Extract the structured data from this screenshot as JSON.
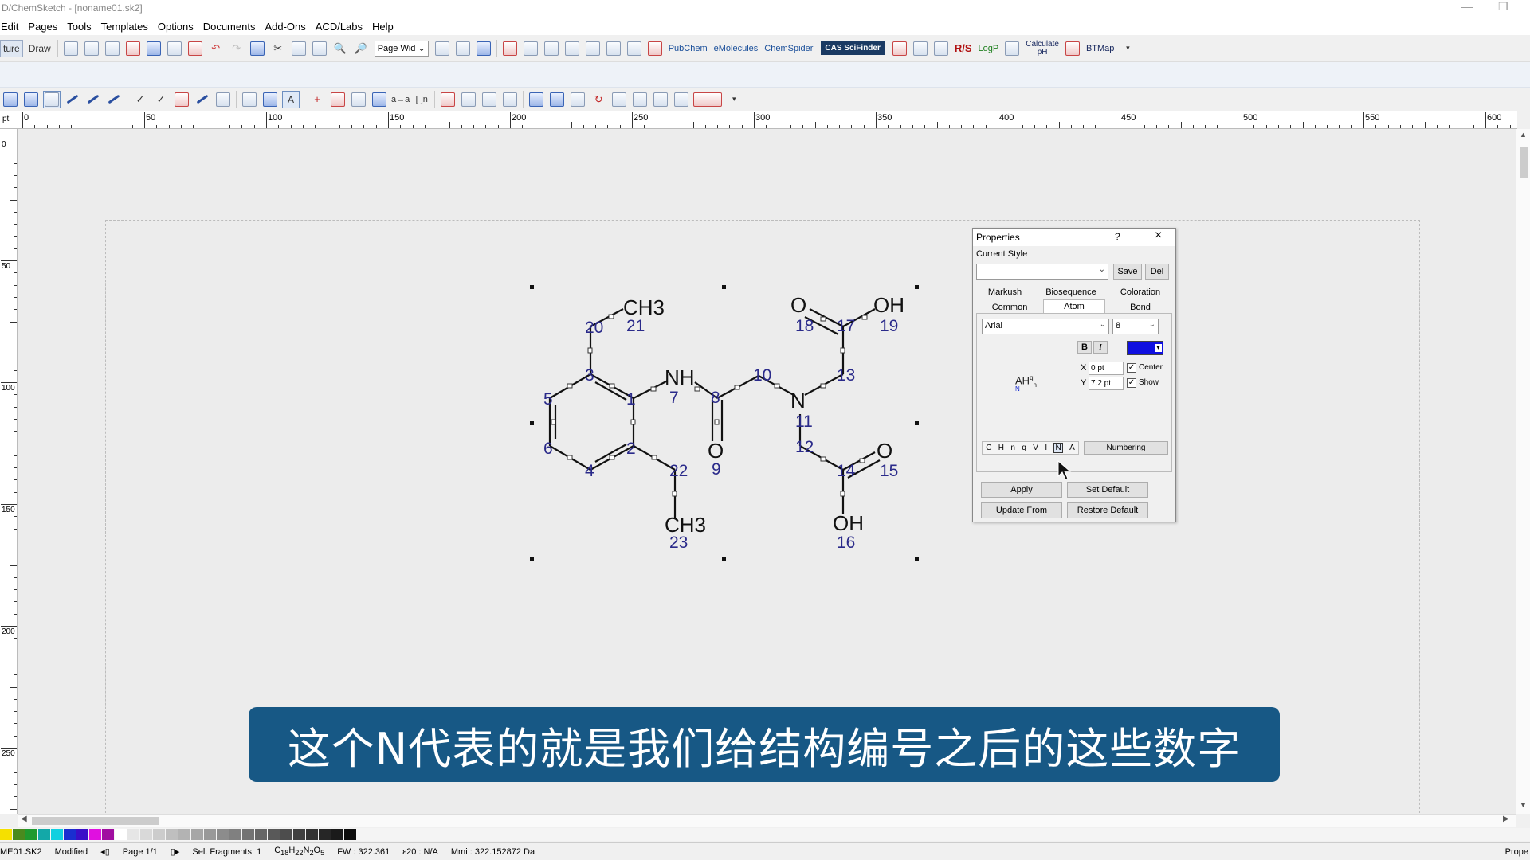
{
  "titlebar": {
    "title": "D/ChemSketch - [noname01.sk2]"
  },
  "menu": [
    "Edit",
    "Pages",
    "Tools",
    "Templates",
    "Options",
    "Documents",
    "Add-Ons",
    "ACD/Labs",
    "Help"
  ],
  "toolbar1": {
    "structure_tab": "ture",
    "draw_tab": "Draw",
    "zoom_select": "Page Wid",
    "pubchem": "PubChem",
    "emolecules": "eMolecules",
    "chemspider": "ChemSpider",
    "cas": "CAS SciFinder",
    "rs": "R/S",
    "logp": "LogP",
    "calculate": "Calculate",
    "ph": "pH",
    "btmap": "BTMap"
  },
  "ruler": {
    "unit": "pt",
    "h_labels": [
      "0",
      "50",
      "100",
      "150",
      "200",
      "250",
      "300",
      "350",
      "400",
      "450",
      "500",
      "550",
      "600"
    ],
    "v_labels": [
      "0",
      "50",
      "100",
      "150",
      "200",
      "250"
    ]
  },
  "molecule": {
    "groups": {
      "ch3_top": "CH3",
      "ch3_bottom": "CH3",
      "nh": "NH",
      "n": "N",
      "o_acid_top": "O",
      "oh_top": "OH",
      "o_9": "O",
      "o_15": "O",
      "oh_16": "OH"
    },
    "numbers": [
      "1",
      "2",
      "3",
      "4",
      "5",
      "6",
      "7",
      "8",
      "9",
      "10",
      "11",
      "12",
      "13",
      "14",
      "15",
      "16",
      "17",
      "18",
      "19",
      "20",
      "21",
      "22",
      "23"
    ]
  },
  "properties": {
    "title": "Properties",
    "help": "?",
    "current_style_label": "Current Style",
    "style_value": "",
    "save": "Save",
    "del": "Del",
    "tabs_row1": [
      "Markush",
      "Biosequence",
      "Coloration"
    ],
    "tabs_row2": [
      "Common",
      "Atom",
      "Bond"
    ],
    "active_tab": "Atom",
    "font": "Arial",
    "size": "8",
    "bold": "B",
    "italic": "I",
    "color": "#1010e0",
    "x_label": "X",
    "x_value": "0 pt",
    "y_label": "Y",
    "y_value": "7.2 pt",
    "center_label": "Center",
    "show_label": "Show",
    "center_checked": true,
    "show_checked": true,
    "preview": "AH",
    "preview_sup": "q",
    "preview_sub": "n",
    "preview_n": "N",
    "label_flags": [
      "C",
      "H",
      "n",
      "q",
      "V",
      "I",
      "N",
      "A"
    ],
    "numbering": "Numbering",
    "apply": "Apply",
    "set_default": "Set Default",
    "update_from": "Update From",
    "restore_default": "Restore Default"
  },
  "caption": "这个N代表的就是我们给结构编号之后的这些数字",
  "status": {
    "file": "ME01.SK2",
    "modified": "Modified",
    "page": "Page 1/1",
    "sel": "Sel. Fragments: 1",
    "formula": "C18H22N2O5",
    "fw": "FW : 322.361",
    "e20": "ε20 : N/A",
    "mmi": "Mmi : 322.152872 Da",
    "right": "Prope"
  },
  "palette": [
    "#f5e000",
    "#4a8a1e",
    "#1f9a2e",
    "#13a8a8",
    "#11d0e0",
    "#1a2ed0",
    "#3a0ec8",
    "#e010e0",
    "#a00ea0",
    "#ffffff",
    "#e6e6e6",
    "#d9d9d9",
    "#cccccc",
    "#bfbfbf",
    "#b3b3b3",
    "#a6a6a6",
    "#999999",
    "#8c8c8c",
    "#808080",
    "#737373",
    "#666666",
    "#595959",
    "#4d4d4d",
    "#404040",
    "#333333",
    "#262626",
    "#1a1a1a",
    "#0d0d0d"
  ]
}
